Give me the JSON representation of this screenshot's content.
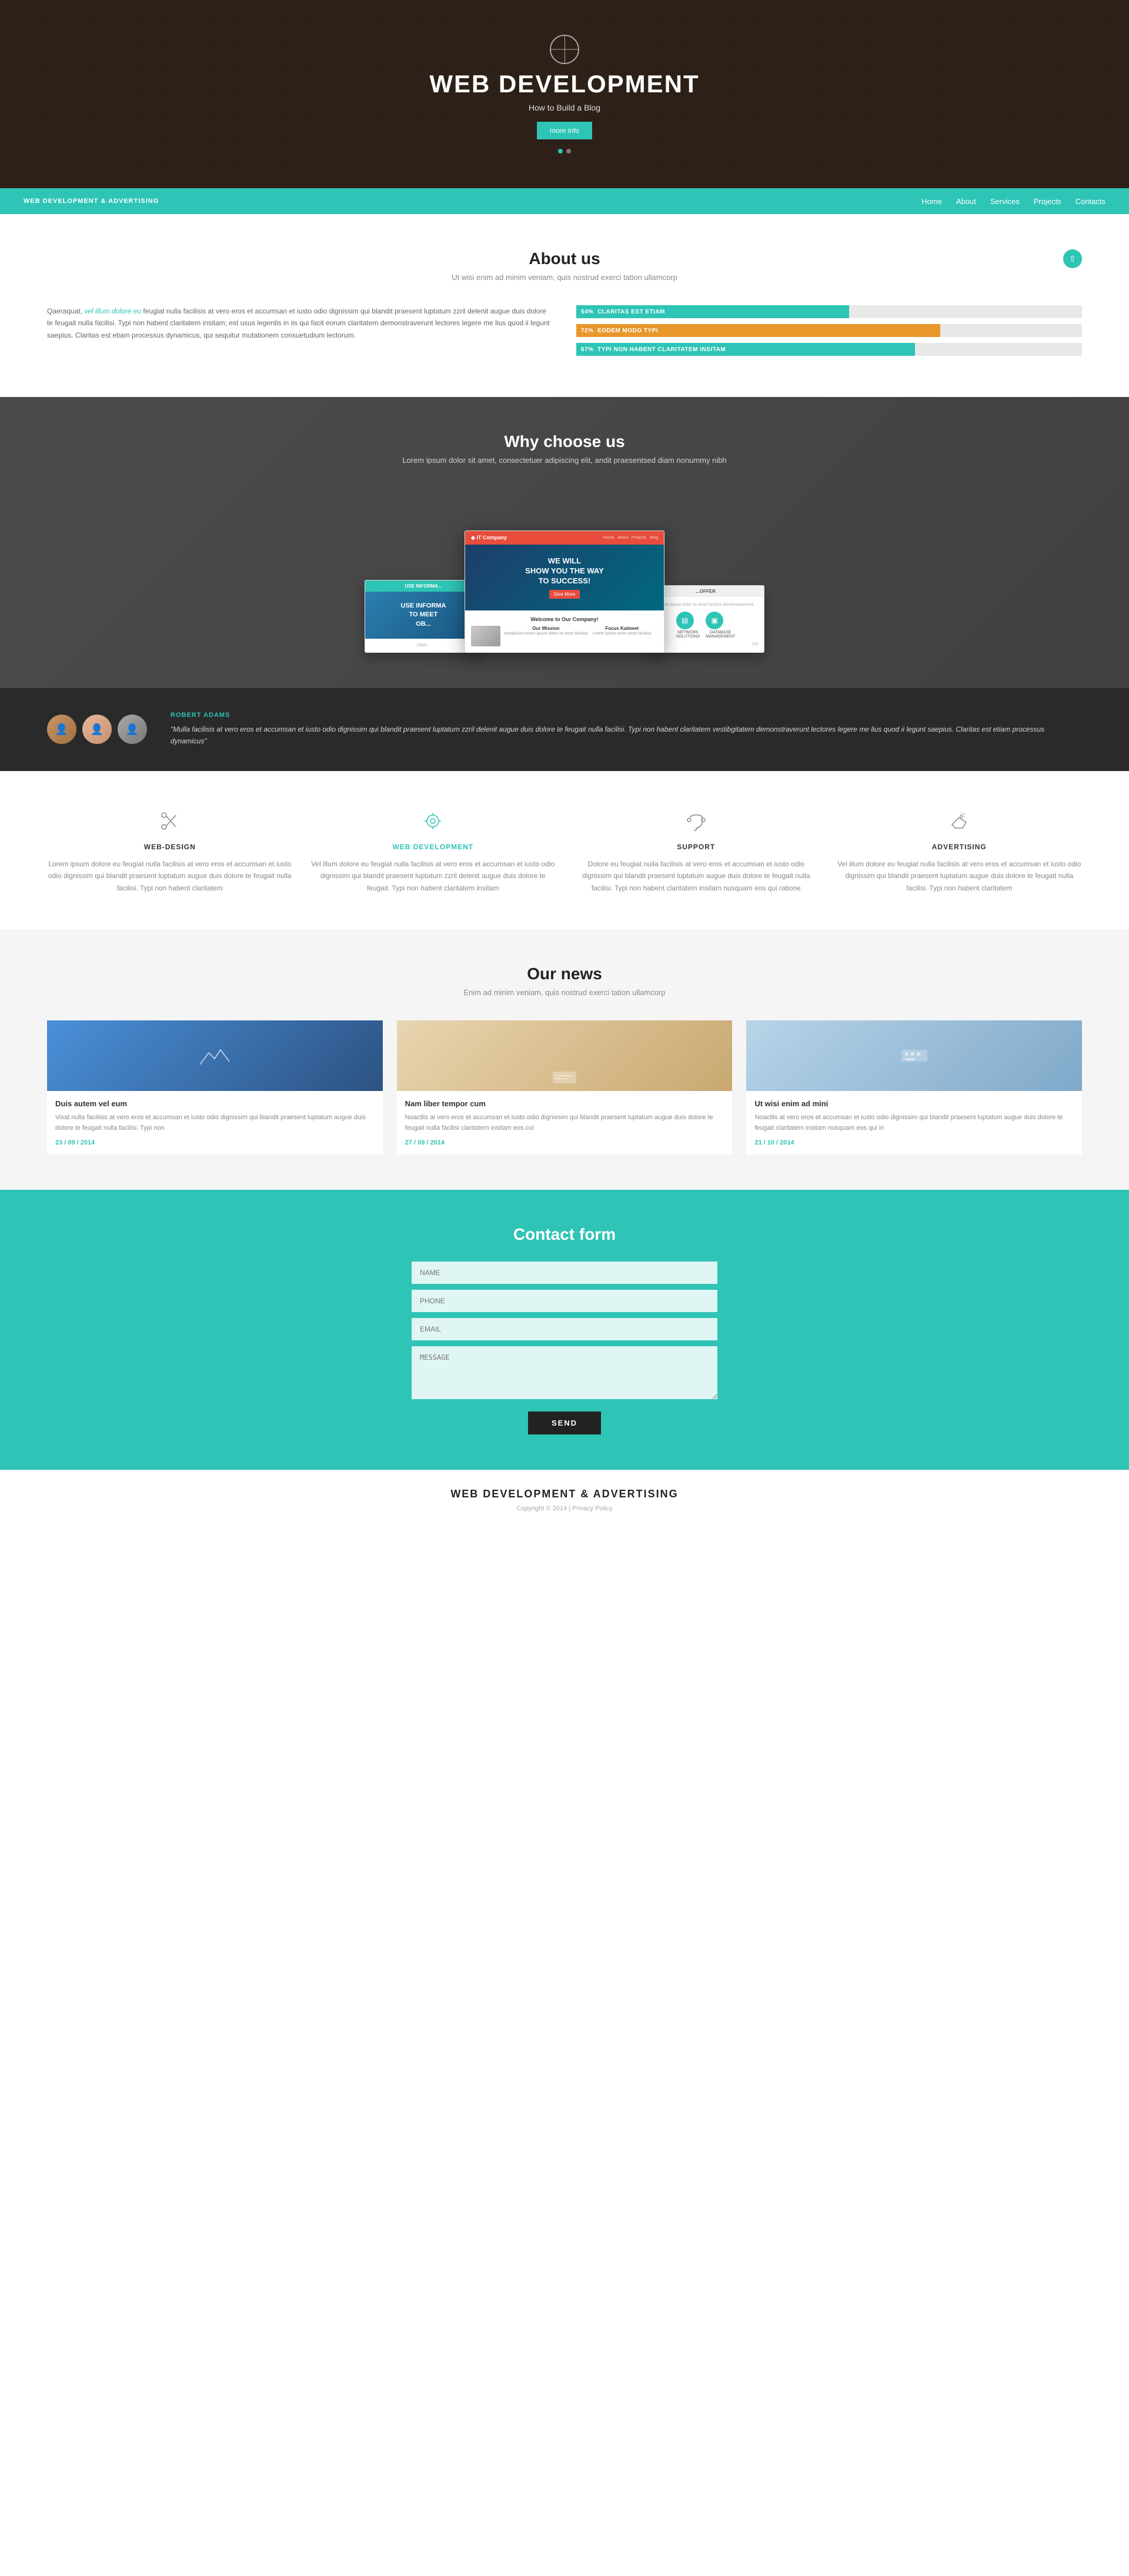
{
  "hero": {
    "title": "Web Development",
    "subtitle": "How to Build a Blog",
    "cta_label": "more info",
    "dots": [
      1,
      2
    ]
  },
  "nav": {
    "brand": "WEB DEVELOPMENT & ADVERTISING",
    "links": [
      {
        "label": "Home",
        "href": "#"
      },
      {
        "label": "About",
        "href": "#"
      },
      {
        "label": "Services",
        "href": "#"
      },
      {
        "label": "Projects",
        "href": "#"
      },
      {
        "label": "Contacts",
        "href": "#"
      }
    ]
  },
  "about": {
    "title": "About us",
    "subtitle": "Ut wisi enim ad minim veniam, quis nostrud exerci tation ullamcorp",
    "text": "Qaeraquat, vel illum dolore eu feugiat nulla facilisis at vero eros et accumsan et iusto odio dignissim qui blandit praesent luptatum zzril delenit augue duis dolore te feugait nulla facilisi. Typi non habent claritatem insitam; est usus legentis in iis qui facit eorum claritatem demonstraverunt lectores legere me lius quod ii legunt saepius. Claritas est etiam processus dynamicus, qui sequitur mutationem consuetudium lectorum.",
    "bars": [
      {
        "label": "CLARITAS EST ETIAM",
        "percent": 54,
        "color": "#2ec4b6"
      },
      {
        "label": "EODEM MODO TYPI",
        "percent": 72,
        "color": "#e8972a"
      },
      {
        "label": "TYPI NON HABENT CLARITATEM INSITAM",
        "percent": 67,
        "color": "#2ec4b6"
      }
    ]
  },
  "why": {
    "title": "Why choose us",
    "subtitle": "Lorem ipsum dolor sit amet, consectetuer adipiscing elit, andit praesentsed diam nonummy nibh"
  },
  "testimonial": {
    "name": "ROBERT ADAMS",
    "quote": "\"Mulla facilisis at vero eros et accumsan et iusto odio dignissim qui blandit praesent luptatum zzril delenit augue duis dolore te feugait nulla facilisi. Typi non habent claritatem vestibgitatem demonstraverunt lectores legere me lius quod ii legunt saepius. Claritas est etiam processus dynamicus\""
  },
  "services": {
    "title": "",
    "items": [
      {
        "icon": "✂",
        "title": "WEB-DESIGN",
        "active": false,
        "text": "Lorem ipsum dolore eu feugiat nulla facilisis at vero eros et accumsan et iusto odio dignissim qui blandit praesent luptatum augue duis dolore te feugait nulla facilisi. Typi non habent claritatem"
      },
      {
        "icon": "⚙",
        "title": "WEB DEVELOPMENT",
        "active": true,
        "text": "Vel illum dolore eu feugiat nulla facilisis at vero eros et accumsan et iusto odio dignissim qui blandit praesent luptatum zzril delenit augue duis dolore te feugait. Typi non habent claritatem insitam"
      },
      {
        "icon": "☎",
        "title": "SUPPORT",
        "active": false,
        "text": "Dolore eu feugiat nulla facilisis at vero eros et accumsan et iusto odio dignissim qui blandit praesent luptatum augue duis dolore te feugait nulla facilisi. Typi non habent claritatem insitam nusquam eos qui ratione"
      },
      {
        "icon": "♪",
        "title": "ADVERTISING",
        "active": false,
        "text": "Vel illum dolore eu feugiat nulla facilisis at vero eros et accumsan et iusto odio dignissim qui blandit praesent luptatum augue duis dolore te feugait nulla facilisi. Typi non habent claritatem"
      }
    ]
  },
  "news": {
    "title": "Our news",
    "subtitle": "Enim ad minim veniam, quis nostrud exerci tation ullamcorp",
    "items": [
      {
        "img_type": "blue",
        "title": "Duis autem vel eum",
        "text": "Vixat nulla facilisis at vero eros et accumsan et iusto odio dignissim qui blandit praesent luptatum augue duis dolore te feugait nulla facilisi. Typi non",
        "date": "23 / 09 / 2014"
      },
      {
        "img_type": "hand",
        "title": "Nam liber tempor cum",
        "text": "Noactlis at vero eros et accumsan et iusto odio dignissim qui blandit praesent luptatum augue duis dolore te feugait nulla facilisi claritatem insitam eos cui",
        "date": "27 / 09 / 2014"
      },
      {
        "img_type": "typing",
        "title": "Ut wisi enim ad mini",
        "text": "Noactlis at vero eros et accumsan et iusto odio dignissim qui blandit praesent luptatum augue duis dolore te feugait claritatem insitam nusquam eos qui in",
        "date": "21 / 10 / 2014"
      }
    ]
  },
  "contact": {
    "title": "Contact form",
    "fields": {
      "name_placeholder": "NAME",
      "phone_placeholder": "PHONE",
      "email_placeholder": "EMAIL",
      "message_placeholder": "MESSAGE"
    },
    "send_label": "SEND"
  },
  "footer": {
    "brand": "WEB DEVELOPMENT & ADVERTISING",
    "copyright": "Copyright © 2014 | Privacy Policy"
  }
}
